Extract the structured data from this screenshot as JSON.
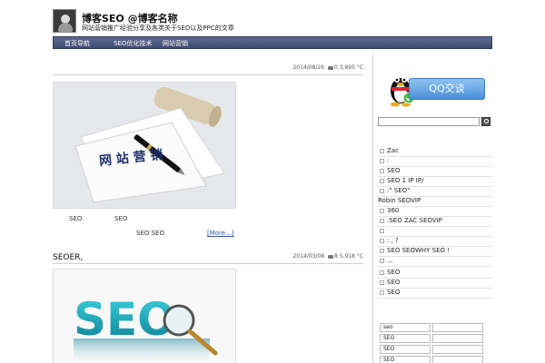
{
  "header": {
    "site_title": "博客SEO @博客名称",
    "site_desc": "网站营销推广经验分享及各类关于SEO以及PPC的文章"
  },
  "nav": {
    "items": [
      "首页导航",
      "SEO优化技术",
      "网站营销"
    ]
  },
  "posts": [
    {
      "date": "2014/08/26",
      "comments": "0",
      "views": "3,895 °C",
      "excerpt_line1_a": "SEO",
      "excerpt_line1_b": "SEO",
      "excerpt_line2": "SEO  SEO",
      "more": "[More...]",
      "image_text": "网 站 营 销"
    },
    {
      "title": "SEOER,",
      "date": "2014/03/08",
      "comments": "8",
      "views": "5,918 °C",
      "image_text": "SEO"
    }
  ],
  "sidebar": {
    "qq_button": "QQ交谈",
    "search_placeholder": "",
    "list": [
      "Zac",
      ":",
      "SEO",
      "SEO        1 IP  IP/",
      ":\" SEO\"",
      "Robin SEOVIP",
      "360",
      ":SEO     ZAC  SEOVIP",
      "",
      ":    ,     ?",
      "SEO   SEOWHY   SEO   !",
      "...",
      "SEO",
      "SEO",
      "SEO"
    ],
    "tags": [
      "seo",
      "",
      "SEO",
      "",
      "SEO",
      "",
      "SEO",
      ""
    ]
  },
  "colors": {
    "nav_bg": "#4a5780",
    "qq_blue": "#4a8fd8",
    "seo_teal": "#1aa6b7"
  }
}
